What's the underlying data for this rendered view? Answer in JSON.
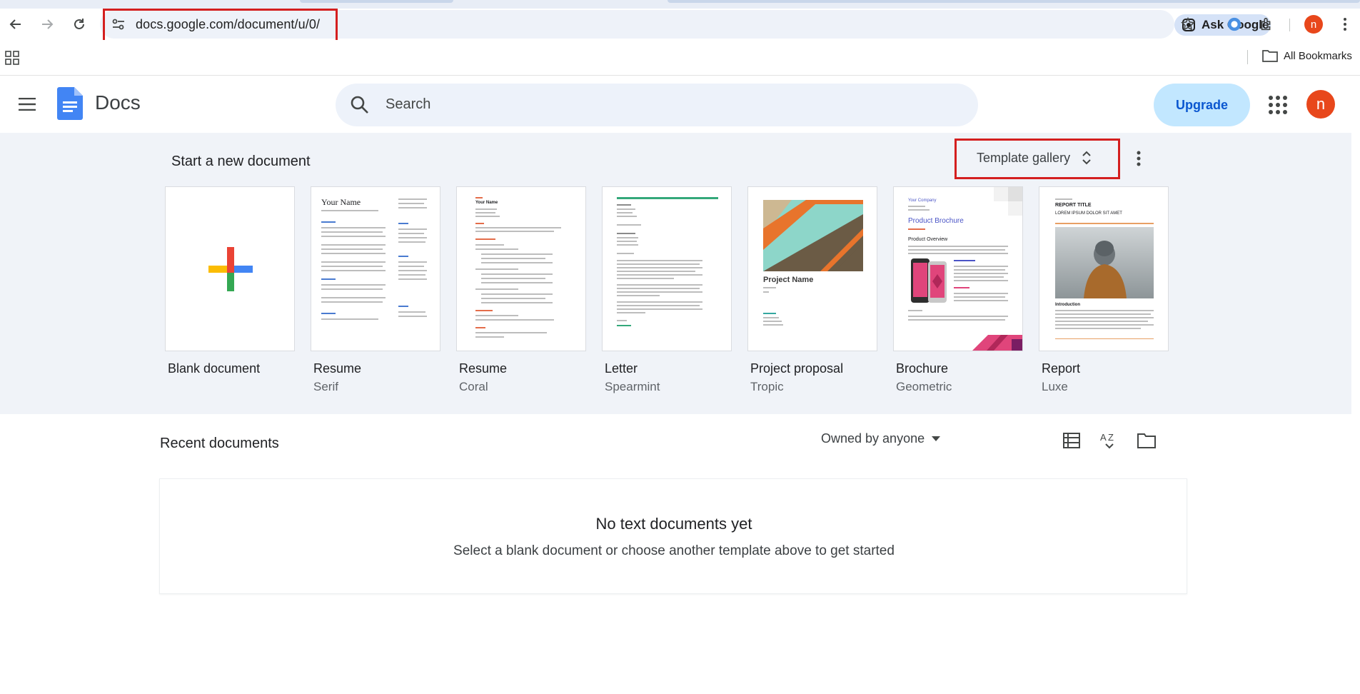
{
  "browser": {
    "url": "docs.google.com/document/u/0/",
    "ask_google_label": "Ask Google",
    "profile_initial": "n",
    "all_bookmarks_label": "All Bookmarks"
  },
  "header": {
    "app_name": "Docs",
    "search_placeholder": "Search",
    "upgrade_label": "Upgrade",
    "avatar_initial": "n"
  },
  "start_section": {
    "title": "Start a new document",
    "template_gallery_label": "Template gallery",
    "templates": [
      {
        "name": "Blank document",
        "sub": ""
      },
      {
        "name": "Resume",
        "sub": "Serif"
      },
      {
        "name": "Resume",
        "sub": "Coral"
      },
      {
        "name": "Letter",
        "sub": "Spearmint"
      },
      {
        "name": "Project proposal",
        "sub": "Tropic"
      },
      {
        "name": "Brochure",
        "sub": "Geometric"
      },
      {
        "name": "Report",
        "sub": "Luxe"
      }
    ],
    "thumb_text": {
      "resume_serif_name": "Your Name",
      "resume_coral_name": "Your Name",
      "proposal_title": "Project Name",
      "brochure_company": "Your Company",
      "brochure_title": "Product Brochure",
      "brochure_overview": "Product Overview",
      "report_title": "REPORT TITLE",
      "report_subtitle": "LOREM IPSUM DOLOR SIT AMET",
      "report_intro": "Introduction"
    }
  },
  "recent": {
    "title": "Recent documents",
    "owner_filter": "Owned by anyone",
    "empty_title": "No text documents yet",
    "empty_subtitle": "Select a blank document or choose another template above to get started"
  },
  "colors": {
    "accent_red": "#d41f1f",
    "upgrade_bg": "#c2e7ff",
    "upgrade_text": "#0b57d0",
    "avatar": "#e8471b",
    "section_bg": "#f0f3f8"
  }
}
